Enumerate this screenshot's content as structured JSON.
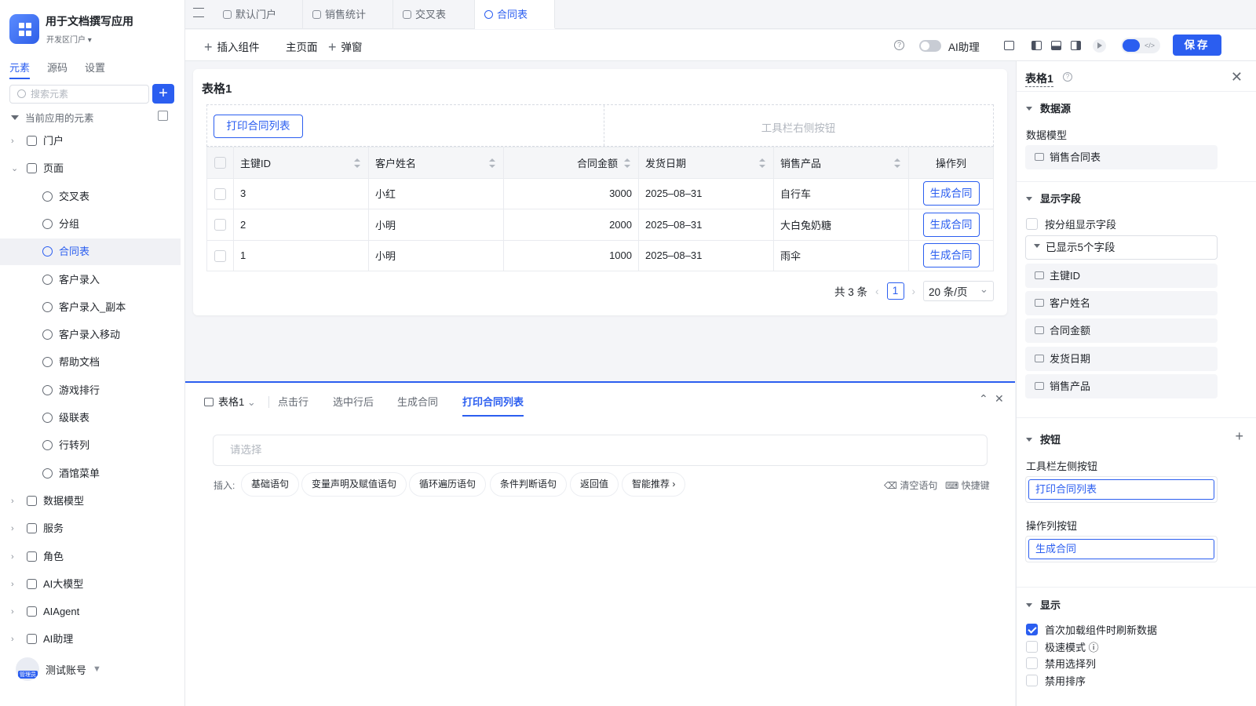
{
  "app": {
    "name": "用于文档撰写应用",
    "portal": "开发区门户"
  },
  "sidebar": {
    "tabs": [
      "元素",
      "源码",
      "设置"
    ],
    "search_placeholder": "搜索元素",
    "root_label": "当前应用的元素",
    "items": [
      {
        "label": "门户",
        "level": 1,
        "icon": "home-icon"
      },
      {
        "label": "页面",
        "level": 1,
        "icon": "pages-icon"
      },
      {
        "label": "交叉表",
        "level": 2,
        "icon": "page-icon"
      },
      {
        "label": "分组",
        "level": 2,
        "icon": "page-icon"
      },
      {
        "label": "合同表",
        "level": 2,
        "icon": "page-icon",
        "active": true
      },
      {
        "label": "客户录入",
        "level": 2,
        "icon": "page-icon"
      },
      {
        "label": "客户录入_副本",
        "level": 2,
        "icon": "page-icon"
      },
      {
        "label": "客户录入移动",
        "level": 2,
        "icon": "page-icon"
      },
      {
        "label": "帮助文档",
        "level": 2,
        "icon": "doc-icon"
      },
      {
        "label": "游戏排行",
        "level": 2,
        "icon": "page-icon"
      },
      {
        "label": "级联表",
        "level": 2,
        "icon": "page-icon"
      },
      {
        "label": "行转列",
        "level": 2,
        "icon": "page-icon"
      },
      {
        "label": "酒馆菜单",
        "level": 2,
        "icon": "page-icon"
      },
      {
        "label": "数据模型",
        "level": 1,
        "icon": "table-icon"
      },
      {
        "label": "服务",
        "level": 1,
        "icon": "service-icon"
      },
      {
        "label": "角色",
        "level": 1,
        "icon": "role-icon"
      },
      {
        "label": "AI大模型",
        "level": 1,
        "icon": "model-icon"
      },
      {
        "label": "AIAgent",
        "level": 1,
        "icon": "robot-icon"
      },
      {
        "label": "AI助理",
        "level": 1,
        "icon": "ai-icon"
      }
    ],
    "user": {
      "name": "测试账号",
      "badge": "管理员"
    }
  },
  "tabs": [
    {
      "label": "默认门户"
    },
    {
      "label": "销售统计"
    },
    {
      "label": "交叉表"
    },
    {
      "label": "合同表",
      "active": true
    }
  ],
  "toolbar": {
    "insert_component": "插入组件",
    "home_page": "主页面",
    "popup": "弹窗",
    "ai_assistant": "AI助理",
    "save": "保存"
  },
  "canvas": {
    "title": "表格1",
    "print_button": "打印合同列表",
    "right_toolbar_placeholder": "工具栏右侧按钮",
    "columns": [
      "主键ID",
      "客户姓名",
      "合同金额",
      "发货日期",
      "销售产品",
      "操作列"
    ],
    "rows": [
      {
        "id": "3",
        "name": "小红",
        "amount": "3000",
        "date": "2025–08–31",
        "product": "自行车",
        "action": "生成合同"
      },
      {
        "id": "2",
        "name": "小明",
        "amount": "2000",
        "date": "2025–08–31",
        "product": "大白兔奶糖",
        "action": "生成合同"
      },
      {
        "id": "1",
        "name": "小明",
        "amount": "1000",
        "date": "2025–08–31",
        "product": "雨伞",
        "action": "生成合同"
      }
    ],
    "pager": {
      "total": "共 3 条",
      "current": "1",
      "page_size": "20 条/页"
    }
  },
  "bottom_panel": {
    "component": "表格1",
    "tabs": [
      "点击行",
      "选中行后",
      "生成合同",
      "打印合同列表"
    ],
    "active_tab": "打印合同列表",
    "select_placeholder": "请选择",
    "insert_label": "插入:",
    "chips": [
      "基础语句",
      "变量声明及赋值语句",
      "循环遍历语句",
      "条件判断语句",
      "返回值",
      "智能推荐 ›"
    ],
    "clear": "清空语句",
    "shortcut": "快捷键"
  },
  "props": {
    "title": "表格1",
    "datasource_section": "数据源",
    "data_model_label": "数据模型",
    "data_model_value": "销售合同表",
    "fields_section": "显示字段",
    "group_fields_label": "按分组显示字段",
    "shown_fields": "已显示5个字段",
    "fields": [
      "主键ID",
      "客户姓名",
      "合同金额",
      "发货日期",
      "销售产品"
    ],
    "buttons_section": "按钮",
    "toolbar_left_label": "工具栏左侧按钮",
    "toolbar_left_value": "打印合同列表",
    "op_col_label": "操作列按钮",
    "op_col_value": "生成合同",
    "display_section": "显示",
    "checks": [
      {
        "label": "首次加载组件时刷新数据",
        "checked": true
      },
      {
        "label": "极速模式 ⓘ",
        "checked": false
      },
      {
        "label": "禁用选择列",
        "checked": false
      },
      {
        "label": "禁用排序",
        "checked": false
      }
    ]
  },
  "colors": {
    "accent": "#2b5ef0",
    "bg": "#f4f5f8"
  }
}
